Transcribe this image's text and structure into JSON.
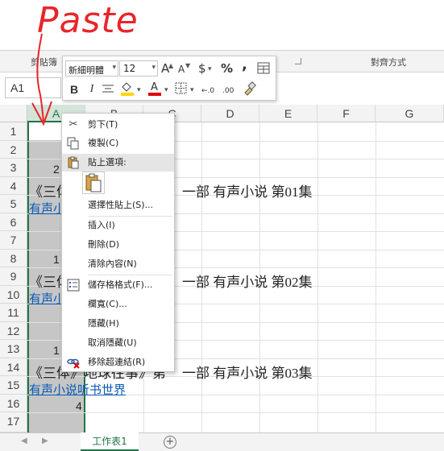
{
  "annotation": {
    "text": "Paste",
    "color": "#e8252a"
  },
  "ribbon": {
    "clipboard_label": "剪貼簿",
    "alignment_label": "對齊方式"
  },
  "name_box": {
    "value": "A1"
  },
  "mini_toolbar": {
    "font_name": "新細明體",
    "font_size": "12",
    "grow_font": "A",
    "shrink_font": "A",
    "currency": "$",
    "percent": "%",
    "comma": ",",
    "bold": "B",
    "italic": "I",
    "decrease_decimal_glyph": "←.0",
    "increase_decimal_glyph": ".00"
  },
  "columns": [
    "A",
    "B",
    "C",
    "D",
    "E",
    "F",
    "G"
  ],
  "rows": [
    "1",
    "2",
    "3",
    "4",
    "5",
    "6",
    "7",
    "8",
    "9",
    "10",
    "11",
    "12",
    "13",
    "14",
    "15",
    "16",
    "17"
  ],
  "cells": {
    "a3": "2",
    "a4": "《三体",
    "d4": "一部 有声小说 第01集",
    "a5": "有声小",
    "a8": "1",
    "a9": "《三体",
    "d9": "一部 有声小说 第02集",
    "a10": "有声小",
    "a13": "1",
    "a14": "《三体》地球往事》第",
    "d14": "一部 有声小说 第03集",
    "a15": "有声小说听书世界",
    "a16": "4"
  },
  "context_menu": {
    "items": [
      {
        "label": "剪下(T)",
        "icon": "scissors-icon"
      },
      {
        "label": "複製(C)",
        "icon": "copy-icon"
      },
      {
        "label": "貼上選項:",
        "icon": "paste-icon"
      },
      {
        "label": "選擇性貼上(S)...",
        "icon": ""
      },
      {
        "label": "插入(I)",
        "icon": ""
      },
      {
        "label": "刪除(D)",
        "icon": ""
      },
      {
        "label": "清除內容(N)",
        "icon": ""
      },
      {
        "label": "儲存格格式(F)...",
        "icon": "format-cells-icon"
      },
      {
        "label": "欄寬(C)...",
        "icon": ""
      },
      {
        "label": "隱藏(H)",
        "icon": ""
      },
      {
        "label": "取消隱藏(U)",
        "icon": ""
      },
      {
        "label": "移除超連結(R)",
        "icon": "remove-link-icon"
      }
    ]
  },
  "sheet_tabs": [
    {
      "label": "工作表1"
    }
  ],
  "colors": {
    "excel_green": "#217346",
    "link_blue": "#0b5bb3",
    "highlight_yellow": "#ffd700",
    "font_red": "#e00000"
  }
}
